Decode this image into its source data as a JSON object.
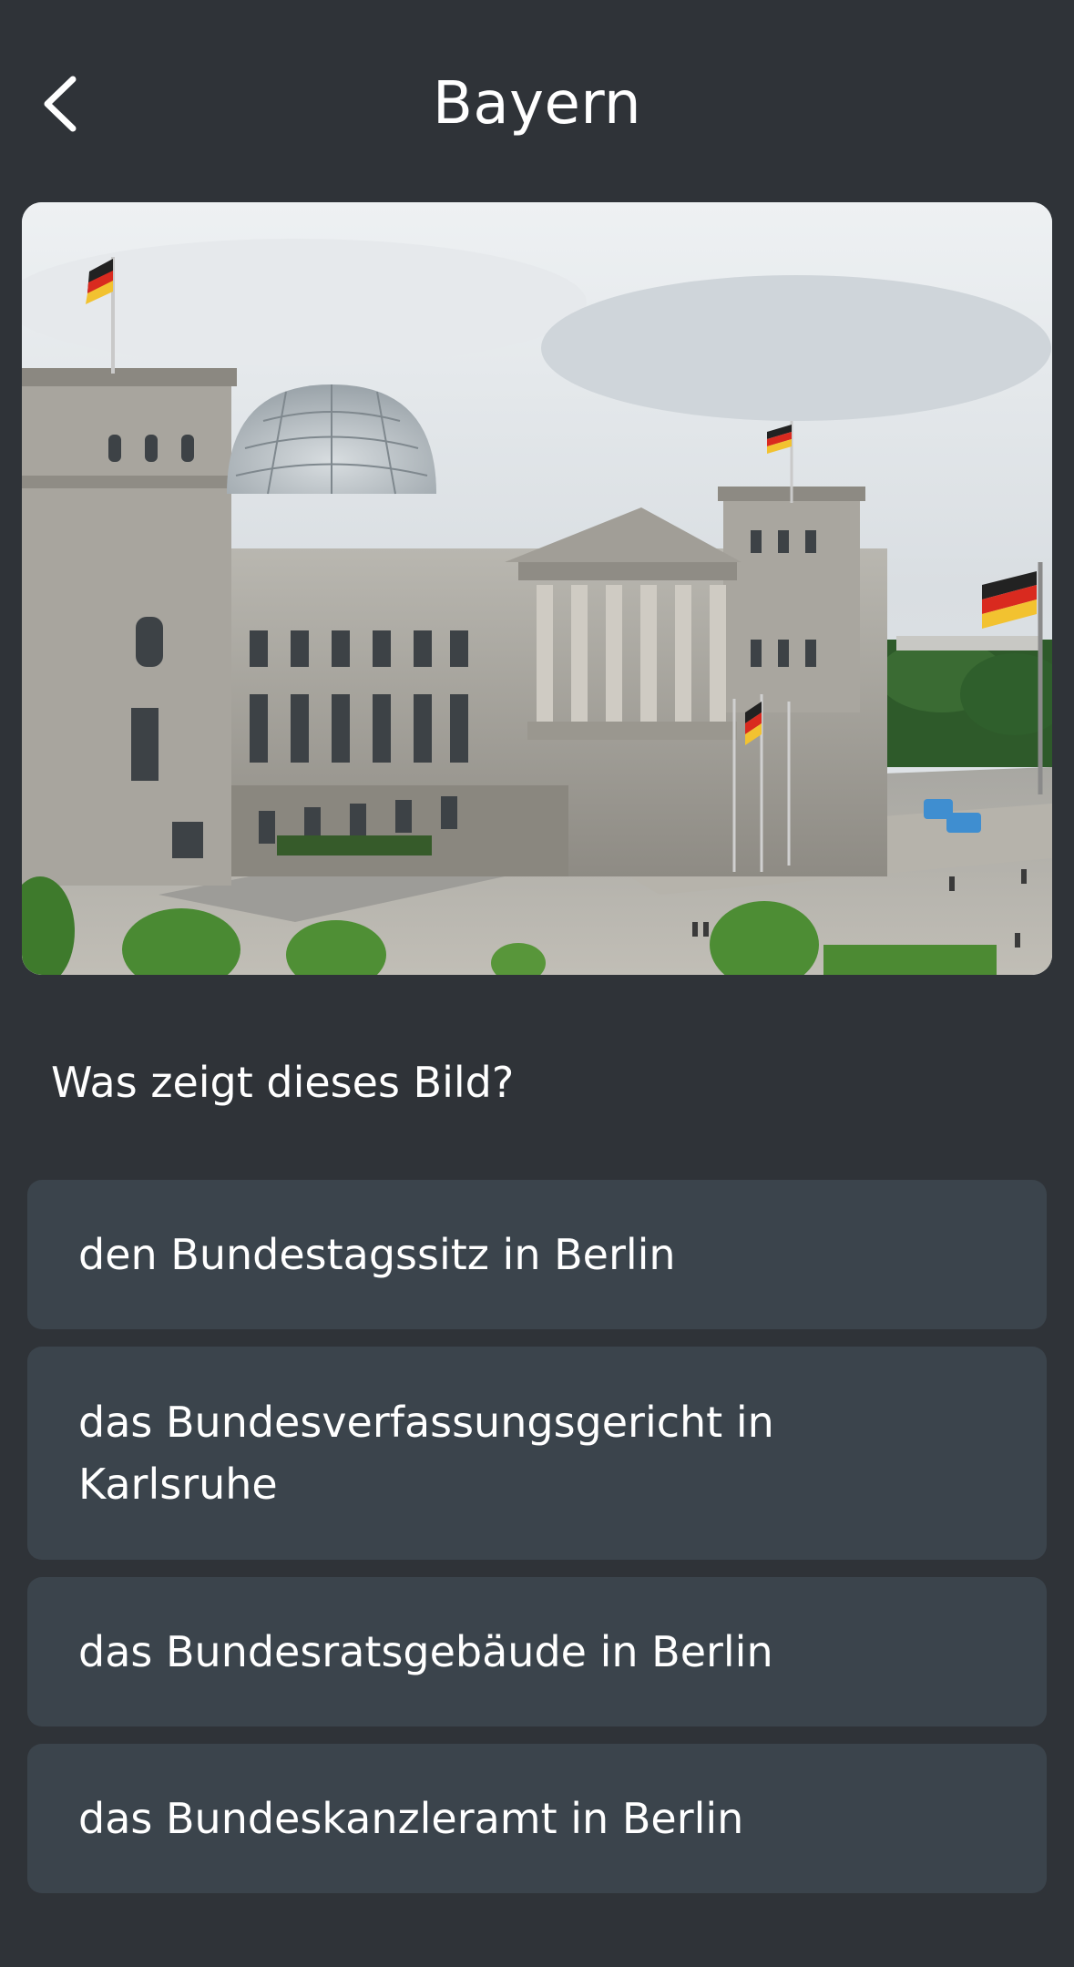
{
  "header": {
    "title": "Bayern",
    "back_icon": "chevron-left-icon"
  },
  "image": {
    "subject_description_hidden": false
  },
  "question": {
    "text": "Was zeigt dieses Bild?"
  },
  "answers": [
    {
      "label": "den Bundestagssitz in Berlin"
    },
    {
      "label": "das Bundesverfassungsgericht in Karlsruhe"
    },
    {
      "label": "das Bundesratsgebäude in Berlin"
    },
    {
      "label": "das Bundeskanzleramt in Berlin"
    }
  ],
  "colors": {
    "background": "#2f3338",
    "answer_background": "#3b444c",
    "text": "#ffffff"
  }
}
